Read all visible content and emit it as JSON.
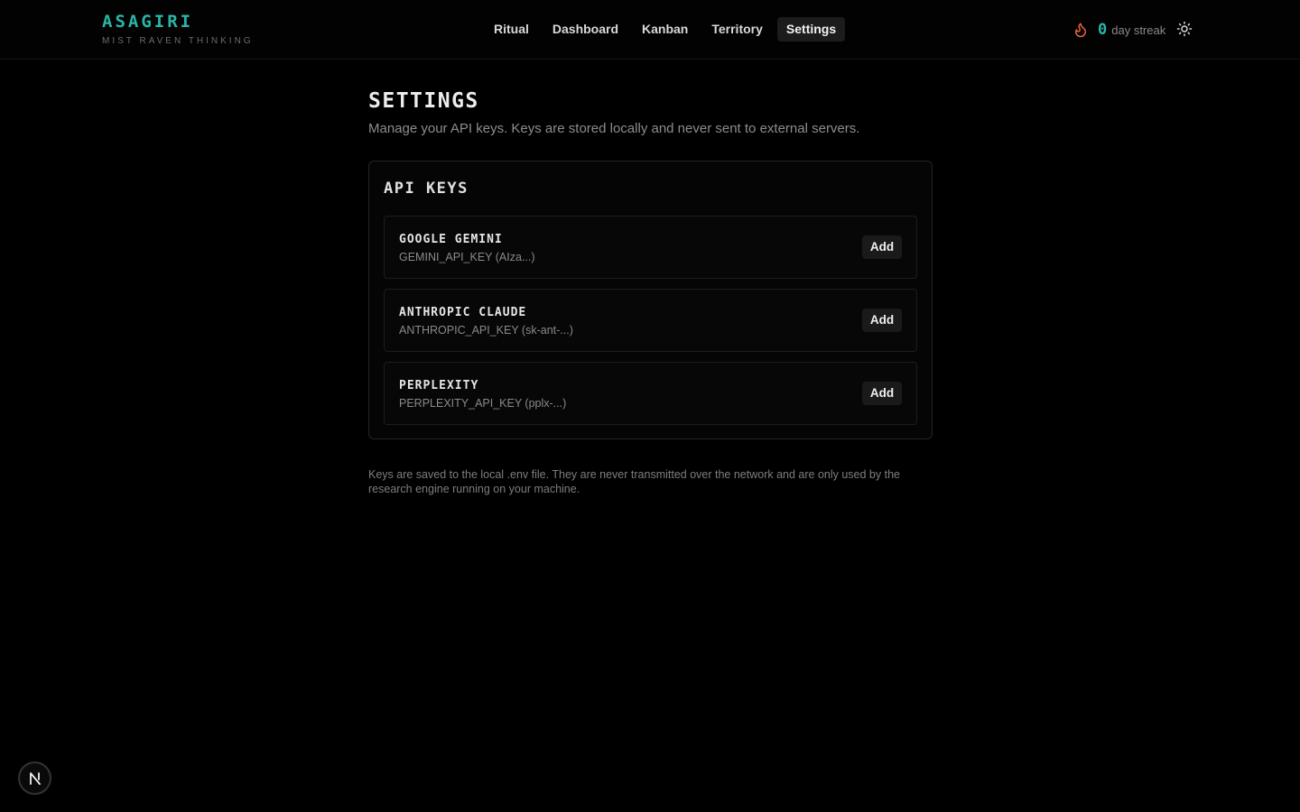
{
  "brand": {
    "title": "ASAGIRI",
    "subtitle": "MIST RAVEN THINKING"
  },
  "nav": {
    "items": [
      {
        "label": "Ritual",
        "active": false
      },
      {
        "label": "Dashboard",
        "active": false
      },
      {
        "label": "Kanban",
        "active": false
      },
      {
        "label": "Territory",
        "active": false
      },
      {
        "label": "Settings",
        "active": true
      }
    ]
  },
  "streak": {
    "icon": "flame-icon",
    "count": "0",
    "label": "day streak"
  },
  "theme_toggle": {
    "icon": "sun-icon"
  },
  "page": {
    "title": "SETTINGS",
    "subtitle": "Manage your API keys. Keys are stored locally and never sent to external servers."
  },
  "api_keys": {
    "title": "API KEYS",
    "items": [
      {
        "name": "GOOGLE GEMINI",
        "env": "GEMINI_API_KEY (AIza...)",
        "action": "Add"
      },
      {
        "name": "ANTHROPIC CLAUDE",
        "env": "ANTHROPIC_API_KEY (sk-ant-...)",
        "action": "Add"
      },
      {
        "name": "PERPLEXITY",
        "env": "PERPLEXITY_API_KEY (pplx-...)",
        "action": "Add"
      }
    ]
  },
  "note": "Keys are saved to the local .env file. They are never transmitted over the network and are only used by the research engine running on your machine.",
  "dev_badge": {
    "icon": "nextjs-icon",
    "letter": "N"
  },
  "colors": {
    "accent": "#2bb5a6",
    "flame": "#e8643c",
    "background": "#000000"
  }
}
